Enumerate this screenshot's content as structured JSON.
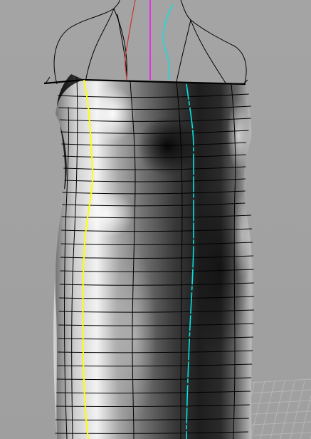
{
  "viewport": {
    "kind": "3d-modeling-perspective-view",
    "object": "dress-surface-mesh",
    "shading": "metallic-grayscale",
    "background_color": "#a3a3a3",
    "mesh_line_color": "#000000",
    "floor_grid_color": "#b4b4b4",
    "curves": [
      {
        "name": "side-seam-curve",
        "color": "#ffff00"
      },
      {
        "name": "center-front-curve",
        "color": "#00e5e5"
      },
      {
        "name": "neck-curve-red",
        "color": "#cc3333"
      },
      {
        "name": "neck-curve-magenta",
        "color": "#ff00ff"
      },
      {
        "name": "neck-curve-cyan",
        "color": "#00e5e5"
      }
    ]
  }
}
